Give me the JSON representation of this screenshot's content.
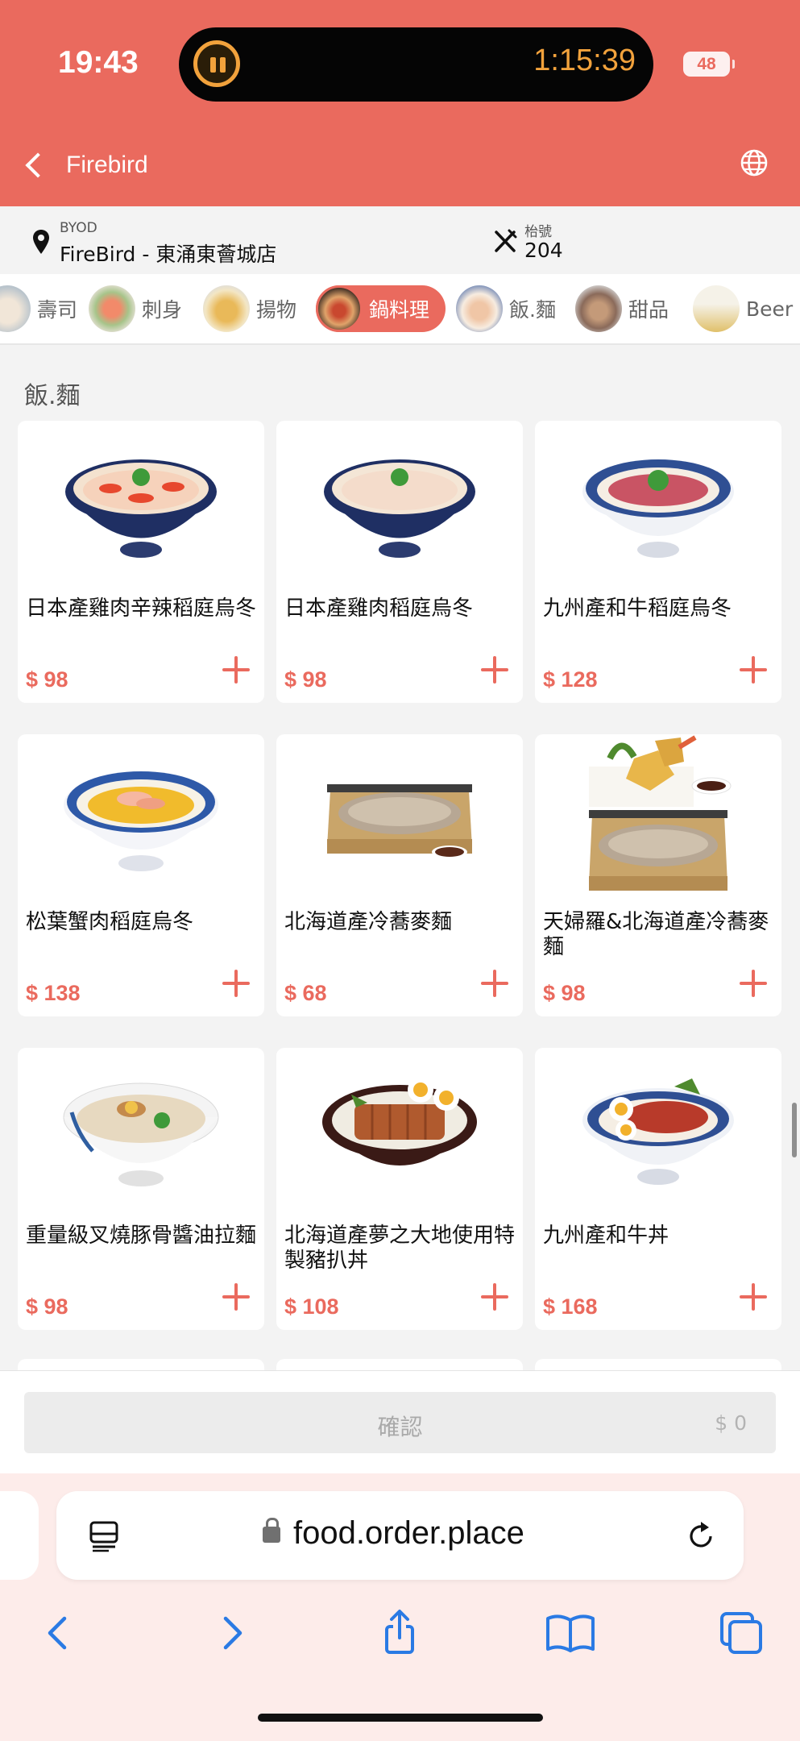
{
  "status_bar": {
    "time": "19:43",
    "timer": "1:15:39",
    "battery": "48"
  },
  "header": {
    "title": "Firebird"
  },
  "info": {
    "mode_label": "BYOD",
    "store": "FireBird - 東涌東薈城店",
    "table_label": "枱號",
    "table_number": "204"
  },
  "categories": [
    {
      "label": "壽司",
      "active": false
    },
    {
      "label": "刺身",
      "active": false
    },
    {
      "label": "揚物",
      "active": false
    },
    {
      "label": "鍋料理",
      "active": true
    },
    {
      "label": "飯.麵",
      "active": false
    },
    {
      "label": "甜品",
      "active": false
    },
    {
      "label": "Beer",
      "active": false
    }
  ],
  "section": {
    "title": "飯.麵"
  },
  "items": [
    {
      "name": "日本產雞肉辛辣稻庭烏冬",
      "price": "$ 98"
    },
    {
      "name": "日本產雞肉稻庭烏冬",
      "price": "$ 98"
    },
    {
      "name": "九州產和牛稻庭烏冬",
      "price": "$ 128"
    },
    {
      "name": "松葉蟹肉稻庭烏冬",
      "price": "$ 138"
    },
    {
      "name": "北海道產冷蕎麥麵",
      "price": "$ 68"
    },
    {
      "name": "天婦羅&北海道產冷蕎麥麵",
      "price": "$ 98"
    },
    {
      "name": "重量級叉燒豚骨醬油拉麵",
      "price": "$ 98"
    },
    {
      "name": "北海道產夢之大地使用特製豬扒丼",
      "price": "$ 108"
    },
    {
      "name": "九州產和牛丼",
      "price": "$ 168"
    }
  ],
  "cart": {
    "confirm_label": "確認",
    "total": "$ 0"
  },
  "browser": {
    "url": "food.order.place"
  },
  "colors": {
    "accent": "#ea6a5e",
    "background": "#f3f3f3",
    "browser_bar": "#fdecea"
  }
}
